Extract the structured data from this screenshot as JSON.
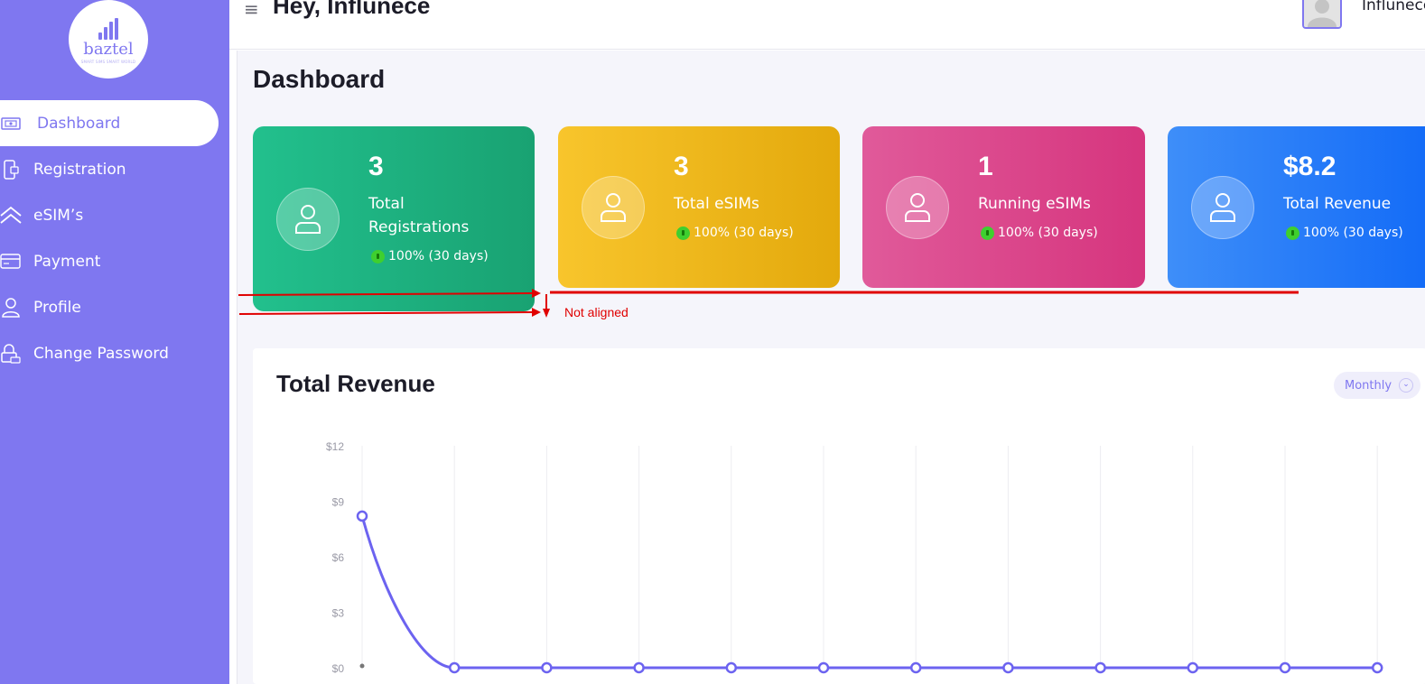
{
  "brand": {
    "logo_text": "baztel",
    "logo_tagline": "SMART SIMS SMART WORLD"
  },
  "sidebar": {
    "items": [
      {
        "label": "Dashboard",
        "icon": "dashboard-icon",
        "active": true
      },
      {
        "label": "Registration",
        "icon": "phone-icon",
        "active": false
      },
      {
        "label": "eSIM’s",
        "icon": "chevrons-up-icon",
        "active": false
      },
      {
        "label": "Payment",
        "icon": "card-icon",
        "active": false
      },
      {
        "label": "Profile",
        "icon": "user-icon",
        "active": false
      },
      {
        "label": "Change Password",
        "icon": "lock-icon",
        "active": false
      }
    ]
  },
  "header": {
    "greeting": "Hey, Influnece",
    "username": "Influnece"
  },
  "page": {
    "title": "Dashboard"
  },
  "stats": [
    {
      "value": "3",
      "label": "Total Registrations",
      "change": "100% (30 days)",
      "colors": [
        "#22c08d",
        "#19a272"
      ]
    },
    {
      "value": "3",
      "label": "Total eSIMs",
      "change": "100% (30 days)",
      "colors": [
        "#f8c52c",
        "#e3a90c"
      ]
    },
    {
      "value": "1",
      "label": "Running eSIMs",
      "change": "100% (30 days)",
      "colors": [
        "#e05a9a",
        "#d6357e"
      ]
    },
    {
      "value": "$8.2",
      "label": "Total Revenue",
      "change": "100% (30 days)",
      "colors": [
        "#3e8ef9",
        "#146cf7"
      ]
    }
  ],
  "annotation": {
    "text": "Not aligned",
    "color": "#e00000"
  },
  "revenue_panel": {
    "title": "Total Revenue",
    "period": "Monthly"
  },
  "chart_data": {
    "type": "line",
    "title": "",
    "xlabel": "",
    "ylabel": "",
    "y_ticks": [
      "$0",
      "$3",
      "$6",
      "$9",
      "$12"
    ],
    "ylim": [
      0,
      12
    ],
    "x": [
      1,
      2,
      3,
      4,
      5,
      6,
      7,
      8,
      9,
      10,
      11,
      12
    ],
    "series": [
      {
        "values": [
          8.2,
          0,
          0,
          0,
          0,
          0,
          0,
          0,
          0,
          0,
          0,
          0
        ],
        "color": "#6c63f0"
      }
    ],
    "grid": "vertical"
  }
}
